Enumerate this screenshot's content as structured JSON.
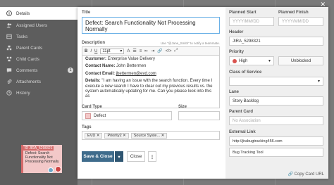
{
  "sidebar": {
    "items": [
      {
        "label": "Details",
        "icon": "info-icon"
      },
      {
        "label": "Assigned Users",
        "icon": "users-icon"
      },
      {
        "label": "Tasks",
        "icon": "tasks-icon"
      },
      {
        "label": "Parent Cards",
        "icon": "parent-cards-icon"
      },
      {
        "label": "Child Cards",
        "icon": "child-cards-icon"
      },
      {
        "label": "Comments",
        "icon": "comments-icon",
        "badge": "1"
      },
      {
        "label": "Attachments",
        "icon": "attachment-icon"
      },
      {
        "label": "History",
        "icon": "history-icon"
      }
    ]
  },
  "mini_card": {
    "id": "ID JIRA_5298321",
    "title": "Defect: Search Functionality Not Processing Normally"
  },
  "form": {
    "title_label": "Title",
    "title_value": "Defect: Search Functionality Not Processing Normally",
    "description_label": "Description",
    "mention_hint": "Use \"@Jane_Smith\" to notify a teammate.",
    "toolbar": {
      "bold": "B",
      "italic": "I",
      "underline": "U",
      "font_size": "11pt"
    },
    "description": {
      "customer_label": "Customer:",
      "customer": "Enterprise Value Delivery",
      "contact_name_label": "Contact Name:",
      "contact_name": "John Bettermen",
      "contact_email_label": "Contact Email:",
      "contact_email": "jbettermen@evd.com",
      "details_label": "Details:",
      "details": "\"I am having an issue with the search function. Every time I execute a new search I have to clear out my previous results vs. the system automatically updating for me. Can you please look into this as"
    },
    "card_type_label": "Card Type",
    "card_type_value": "Defect",
    "size_label": "Size",
    "tags_label": "Tags",
    "tags": [
      "EVD",
      "Priority2",
      "Source Syste..."
    ],
    "save_close_label": "Save & Close",
    "close_label": "Close"
  },
  "right": {
    "planned_start_label": "Planned Start",
    "planned_start_placeholder": "YYYY/MM/DD",
    "planned_finish_label": "Planned Finish",
    "planned_finish_placeholder": "YYYY/MM/DD",
    "header_label": "Header",
    "header_value": "JIRA_5298321",
    "priority_label": "Priority",
    "priority_value": "High",
    "unblocked_label": "Unblocked",
    "class_label": "Class of Service",
    "class_value": "",
    "lane_label": "Lane",
    "lane_value": "Story Backlog",
    "parent_card_label": "Parent Card",
    "parent_card_placeholder": "No Association",
    "external_link_label": "External Link",
    "external_link_value": "http://jirabugtracking456.com",
    "external_link_title": "Bug Tracking Tool",
    "copy_url_label": "Copy Card URL"
  },
  "colors": {
    "accent": "#3f6c8c",
    "defect": "#f3c8c8",
    "priority_high": "#d9534f"
  }
}
